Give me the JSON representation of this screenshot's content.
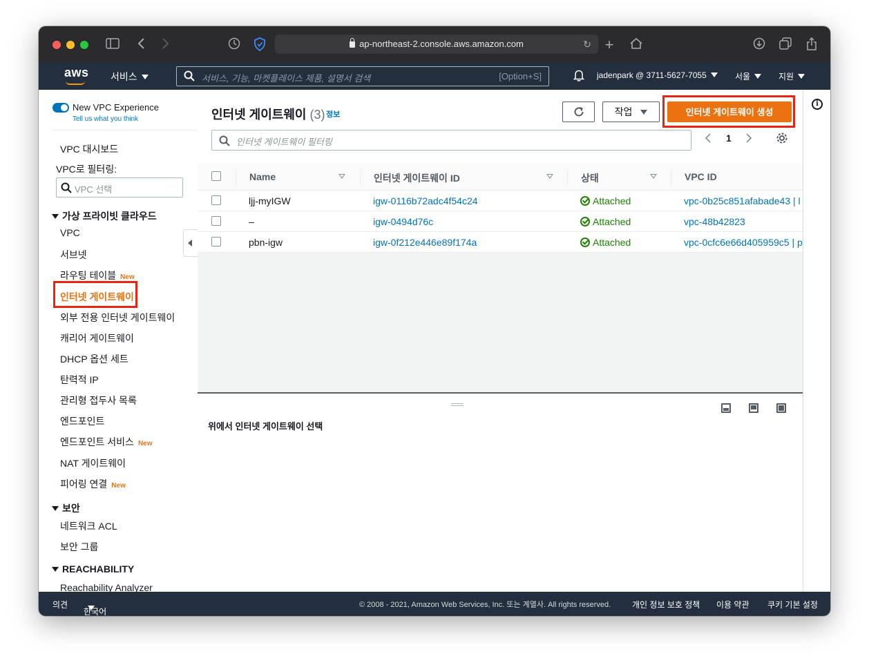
{
  "browser": {
    "url": "ap-northeast-2.console.aws.amazon.com"
  },
  "topnav": {
    "logo": "aws",
    "services": "서비스",
    "search_placeholder": "서비스, 기능, 마켓플레이스 제품, 설명서 검색",
    "search_shortcut": "[Option+S]",
    "account": "jadenpark @ 3711-5627-7055",
    "region": "서울",
    "support": "지원"
  },
  "sidebar": {
    "new_vpc_experience": "New VPC Experience",
    "tell_us": "Tell us what you think",
    "dashboard": "VPC 대시보드",
    "filter_label": "VPC로 필터링:",
    "filter_placeholder": "VPC 선택",
    "section_vpc": "가상 프라이빗 클라우드",
    "items_vpc": [
      {
        "label": "VPC",
        "new": ""
      },
      {
        "label": "서브넷",
        "new": ""
      },
      {
        "label": "라우팅 테이블",
        "new": "New"
      },
      {
        "label": "인터넷 게이트웨이",
        "new": ""
      },
      {
        "label": "외부 전용 인터넷 게이트웨이",
        "new": ""
      },
      {
        "label": "캐리어 게이트웨이",
        "new": ""
      },
      {
        "label": "DHCP 옵션 세트",
        "new": ""
      },
      {
        "label": "탄력적 IP",
        "new": ""
      },
      {
        "label": "관리형 접두사 목록",
        "new": ""
      },
      {
        "label": "엔드포인트",
        "new": ""
      },
      {
        "label": "엔드포인트 서비스",
        "new": "New"
      },
      {
        "label": "NAT 게이트웨이",
        "new": ""
      },
      {
        "label": "피어링 연결",
        "new": "New"
      }
    ],
    "section_security": "보안",
    "items_security": [
      "네트워크 ACL",
      "보안 그룹"
    ],
    "section_reachability": "REACHABILITY",
    "items_reachability": [
      "Reachability Analyzer"
    ]
  },
  "main": {
    "title": "인터넷 게이트웨이",
    "count": "(3)",
    "info": "정보",
    "actions": "작업",
    "create_button": "인터넷 게이트웨이 생성",
    "filter_placeholder": "인터넷 게이트웨이 필터링",
    "page": "1",
    "columns": [
      "Name",
      "인터넷 게이트웨이 ID",
      "상태",
      "VPC ID"
    ],
    "rows": [
      {
        "name": "ljj-myIGW",
        "id": "igw-0116b72adc4f54c24",
        "state": "Attached",
        "vpc": "vpc-0b25c851afabade43 | l"
      },
      {
        "name": "–",
        "id": "igw-0494d76c",
        "state": "Attached",
        "vpc": "vpc-48b42823"
      },
      {
        "name": "pbn-igw",
        "id": "igw-0f212e446e89f174a",
        "state": "Attached",
        "vpc": "vpc-0cfc6e66d405959c5 | p"
      }
    ],
    "detail_message": "위에서 인터넷 게이트웨이 선택"
  },
  "footer": {
    "feedback": "의견",
    "language": "한국어",
    "copyright": "© 2008 - 2021, Amazon Web Services, Inc. 또는 계열사. All rights reserved.",
    "privacy": "개인 정보 보호 정책",
    "terms": "이용 약관",
    "cookies": "쿠키 기본 설정"
  },
  "colors": {
    "accent": "#ec7211",
    "nav_bg": "#232f3e",
    "link": "#0073bb",
    "success": "#1d8102",
    "highlight_box": "#e8230f"
  }
}
